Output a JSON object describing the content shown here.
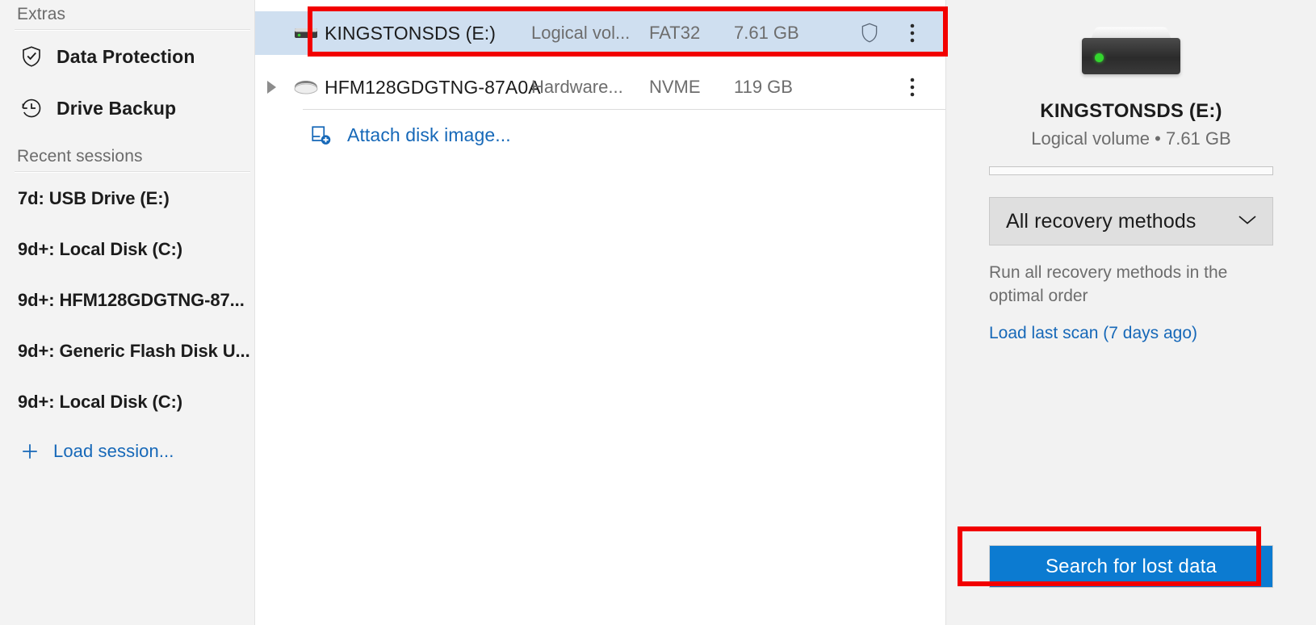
{
  "sidebar": {
    "section_label": "Extras",
    "items": [
      {
        "label": "Data Protection",
        "icon": "shield-check-icon"
      },
      {
        "label": "Drive Backup",
        "icon": "clock-rewind-icon"
      }
    ],
    "recent_label": "Recent sessions",
    "sessions": [
      {
        "label": "7d: USB Drive (E:)"
      },
      {
        "label": "9d+: Local Disk (C:)"
      },
      {
        "label": "9d+: HFM128GDGTNG-87..."
      },
      {
        "label": "9d+: Generic Flash Disk U..."
      },
      {
        "label": "9d+: Local Disk (C:)"
      }
    ],
    "load_session": {
      "label": "Load session...",
      "icon": "plus-icon"
    }
  },
  "drive_list": {
    "rows": [
      {
        "name": "KINGSTONSDS (E:)",
        "kind": "Logical vol...",
        "filesystem": "FAT32",
        "size": "7.61 GB",
        "selected": true,
        "has_shield": true,
        "has_expander": false,
        "icon": "usb-flash-drive-icon"
      },
      {
        "name": "HFM128GDGTNG-87A0A",
        "kind": "Hardware...",
        "filesystem": "NVME",
        "size": "119 GB",
        "selected": false,
        "has_shield": false,
        "has_expander": true,
        "icon": "hard-disk-icon"
      }
    ],
    "attach_disk_image": {
      "label": "Attach disk image...",
      "icon": "attach-disk-image-icon"
    }
  },
  "details_panel": {
    "drive_illustration": "external-hard-drive-icon",
    "title": "KINGSTONSDS (E:)",
    "subtitle": "Logical volume • 7.61 GB",
    "recovery_method": "All recovery methods",
    "recovery_chevron": "chevron-down-icon",
    "description": "Run all recovery methods in the optimal order",
    "load_last_scan": "Load last scan (7 days ago)",
    "search_button": "Search for lost data"
  },
  "colors": {
    "accent_blue": "#0c7bd1",
    "link_blue": "#1668b8",
    "selection_blue": "#cfdff0",
    "annotation_red": "#f20000",
    "sidebar_bg": "#f3f3f3",
    "panel_bg": "#f2f2f2",
    "led_green": "#33d62e"
  }
}
